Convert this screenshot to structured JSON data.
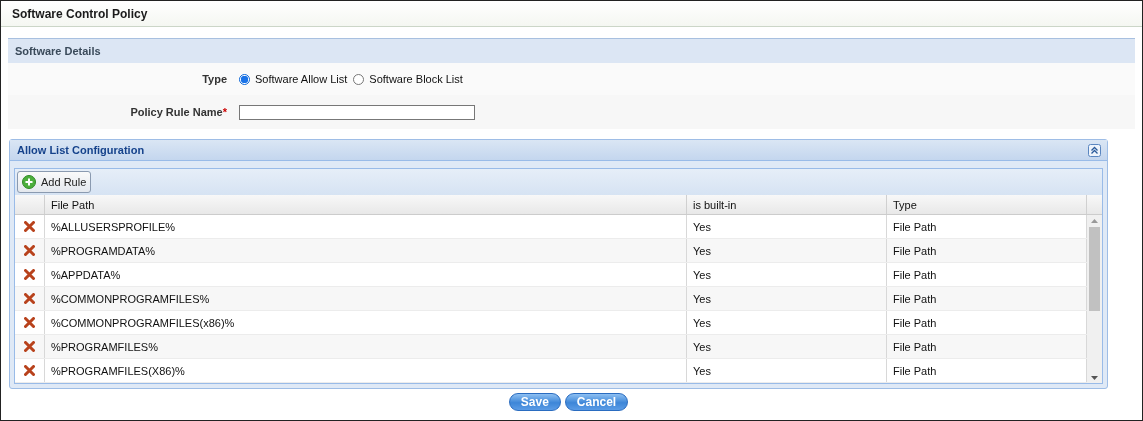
{
  "window": {
    "title": "Software Control Policy"
  },
  "details": {
    "title": "Software Details",
    "type_label": "Type",
    "type_options": [
      {
        "label": "Software Allow List",
        "selected": true
      },
      {
        "label": "Software Block List",
        "selected": false
      }
    ],
    "rule_name_label": "Policy Rule Name",
    "required_mark": "*"
  },
  "panel": {
    "title": "Allow List Configuration",
    "add_button": "Add Rule",
    "columns": [
      "File Path",
      "is built-in",
      "Type"
    ],
    "rows": [
      {
        "file_path": "%ALLUSERSPROFILE%",
        "built_in": "Yes",
        "type": "File Path"
      },
      {
        "file_path": "%PROGRAMDATA%",
        "built_in": "Yes",
        "type": "File Path"
      },
      {
        "file_path": "%APPDATA%",
        "built_in": "Yes",
        "type": "File Path"
      },
      {
        "file_path": "%COMMONPROGRAMFILES%",
        "built_in": "Yes",
        "type": "File Path"
      },
      {
        "file_path": "%COMMONPROGRAMFILES(x86)%",
        "built_in": "Yes",
        "type": "File Path"
      },
      {
        "file_path": "%PROGRAMFILES%",
        "built_in": "Yes",
        "type": "File Path"
      },
      {
        "file_path": "%PROGRAMFILES(X86)%",
        "built_in": "Yes",
        "type": "File Path"
      }
    ]
  },
  "buttons": [
    "Save",
    "Cancel"
  ]
}
